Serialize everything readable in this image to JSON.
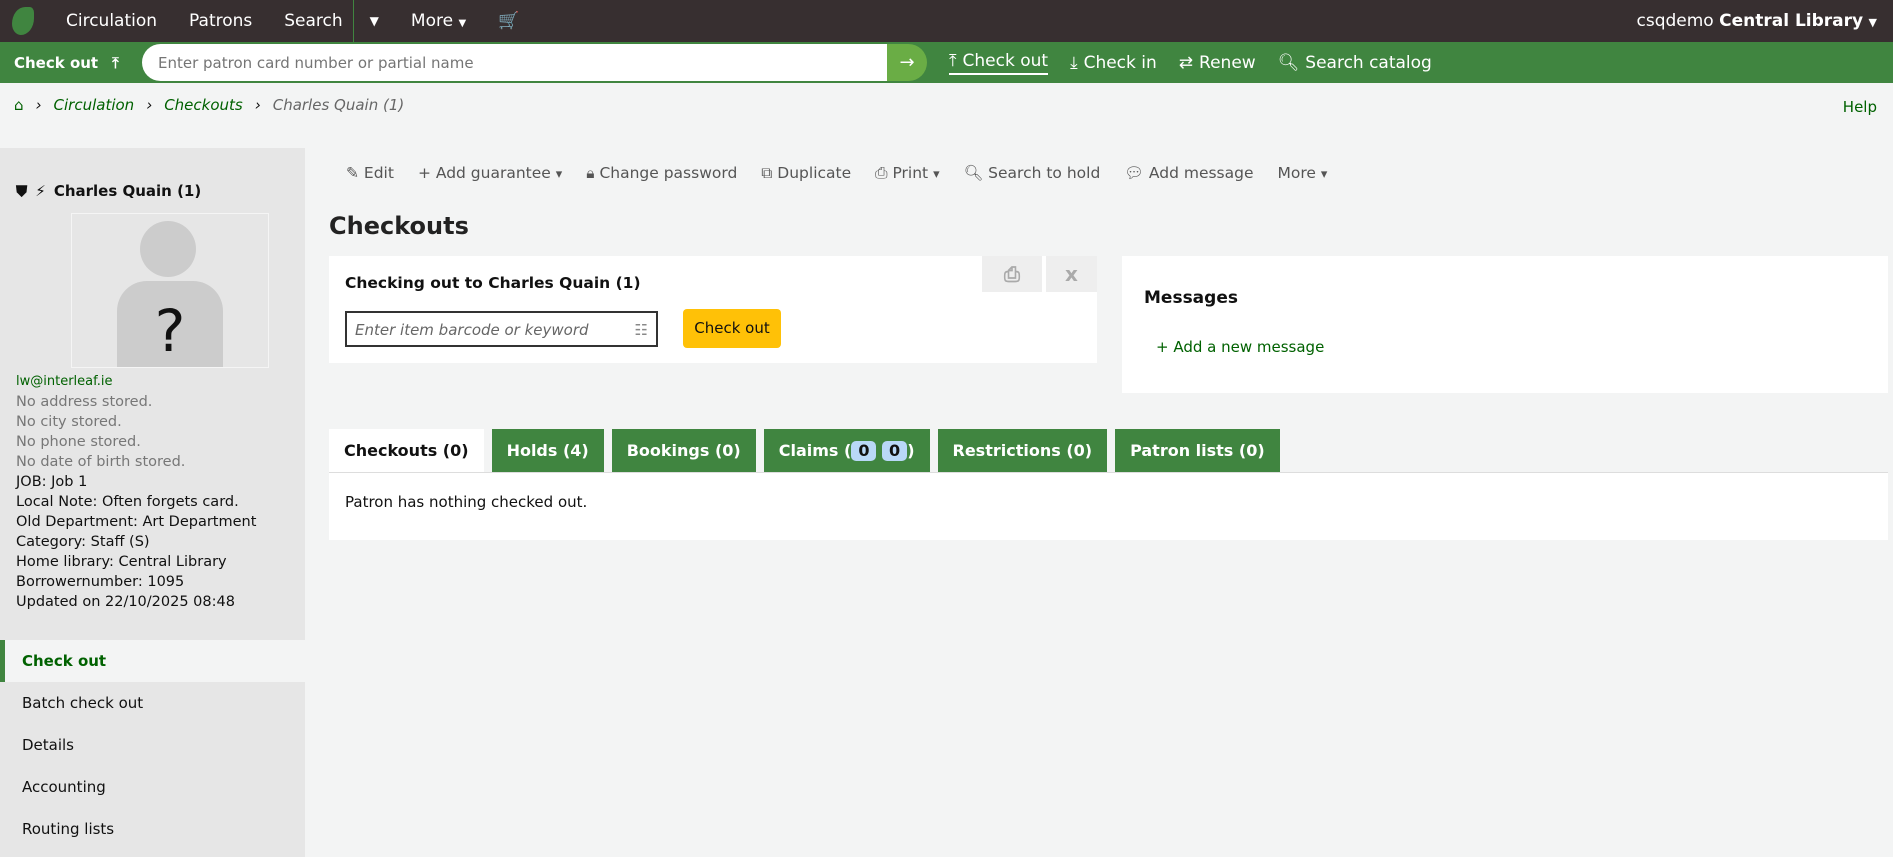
{
  "topnav": {
    "items": [
      "Circulation",
      "Patrons",
      "Search",
      "More"
    ],
    "user": "csqdemo",
    "library": "Central Library"
  },
  "quickbar": {
    "mode": "Check out",
    "placeholder": "Enter patron card number or partial name",
    "links": [
      "Check out",
      "Check in",
      "Renew",
      "Search catalog"
    ]
  },
  "breadcrumb": [
    "Circulation",
    "Checkouts",
    "Charles Quain (1)"
  ],
  "help": "Help",
  "patron": {
    "name": "Charles Quain (1)",
    "email": "lw@interleaf.ie",
    "missing": [
      "No address stored.",
      "No city stored.",
      "No phone stored.",
      "No date of birth stored."
    ],
    "details": [
      "JOB: Job 1",
      "Local Note: Often forgets card.",
      "Old Department: Art Department",
      "Category: Staff (S)",
      "Home library: Central Library",
      "Borrowernumber: 1095",
      "Updated on 22/10/2025 08:48"
    ]
  },
  "sidenav": [
    "Check out",
    "Batch check out",
    "Details",
    "Accounting",
    "Routing lists"
  ],
  "toolbar": [
    "Edit",
    "Add guarantee",
    "Change password",
    "Duplicate",
    "Print",
    "Search to hold",
    "Add message",
    "More"
  ],
  "heading": "Checkouts",
  "checkout": {
    "title": "Checking out to Charles Quain (1)",
    "placeholder": "Enter item barcode or keyword",
    "button": "Check out",
    "close": "x"
  },
  "messages": {
    "title": "Messages",
    "add": "Add a new message"
  },
  "tabs": {
    "checkouts": "Checkouts (0)",
    "holds": "Holds (4)",
    "bookings": "Bookings (0)",
    "claims": "Claims (",
    "claims_a": "0",
    "claims_b": "0",
    "claims_end": ")",
    "restrictions": "Restrictions (0)",
    "lists": "Patron lists (0)"
  },
  "panel": "Patron has nothing checked out."
}
